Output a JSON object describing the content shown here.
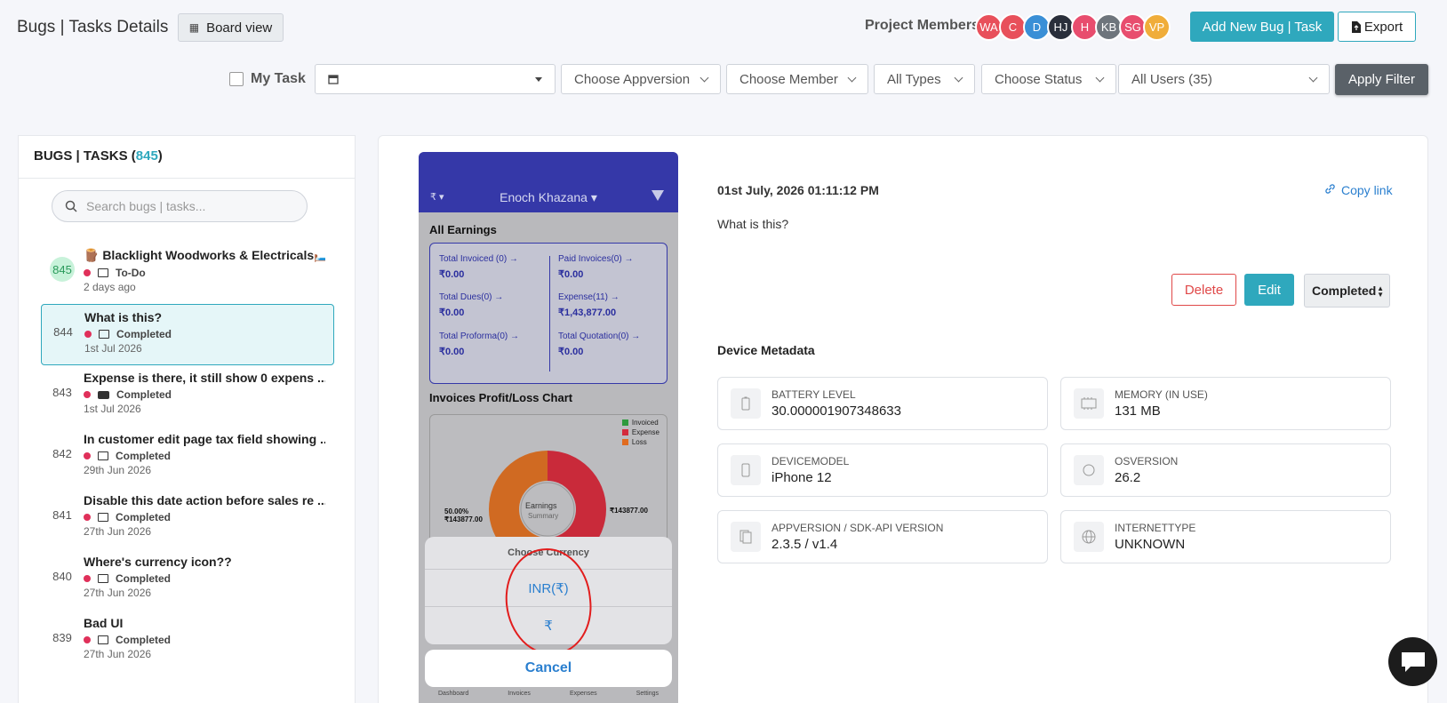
{
  "header": {
    "title": "Bugs | Tasks Details",
    "board_view": "Board view",
    "members_label": "Project Members",
    "members": [
      {
        "initials": "WA",
        "color": "#e8505b"
      },
      {
        "initials": "C",
        "color": "#e8505b"
      },
      {
        "initials": "D",
        "color": "#3a8fd6"
      },
      {
        "initials": "HJ",
        "color": "#2a2f3b"
      },
      {
        "initials": "H",
        "color": "#e84d6e"
      },
      {
        "initials": "KB",
        "color": "#6e757c"
      },
      {
        "initials": "SG",
        "color": "#e84d6e"
      },
      {
        "initials": "VP",
        "color": "#f0ad3a"
      }
    ],
    "add_button": "Add New Bug | Task",
    "export_button": "Export"
  },
  "filters": {
    "my_task": "My Task",
    "date_value": "",
    "appversion": "Choose Appversion",
    "member": "Choose Member",
    "types": "All Types",
    "status": "Choose Status",
    "users": "All Users (35)",
    "apply": "Apply Filter"
  },
  "list": {
    "heading_prefix": "BUGS | TASKS (",
    "count": "845",
    "heading_suffix": ")",
    "search_placeholder": "Search bugs | tasks...",
    "items": [
      {
        "num": "845",
        "title": "🪵 Blacklight Woodworks & Electricals🛏️ ...",
        "status": "To-Do",
        "date": "2 days ago",
        "media": "image"
      },
      {
        "num": "844",
        "title": "What is this?",
        "status": "Completed",
        "date": "1st Jul 2026",
        "media": "image"
      },
      {
        "num": "843",
        "title": "Expense is there, it still show 0 expens ...",
        "status": "Completed",
        "date": "1st Jul 2026",
        "media": "video"
      },
      {
        "num": "842",
        "title": "In customer edit page tax field showing ...",
        "status": "Completed",
        "date": "29th Jun 2026",
        "media": "image"
      },
      {
        "num": "841",
        "title": "Disable this date action before sales re ...",
        "status": "Completed",
        "date": "27th Jun 2026",
        "media": "image"
      },
      {
        "num": "840",
        "title": "Where's currency icon??",
        "status": "Completed",
        "date": "27th Jun 2026",
        "media": "image"
      },
      {
        "num": "839",
        "title": "Bad UI",
        "status": "Completed",
        "date": "27th Jun 2026",
        "media": "image"
      }
    ]
  },
  "phone": {
    "currency": "₹ ▾",
    "business": "Enoch Khazana ▾",
    "all_earnings": "All Earnings",
    "earnings": [
      {
        "label": "Total Invoiced (0) →",
        "value": "₹0.00"
      },
      {
        "label": "Paid Invoices(0) →",
        "value": "₹0.00"
      },
      {
        "label": "Total Dues(0) →",
        "value": "₹0.00"
      },
      {
        "label": "Expense(11) →",
        "value": "₹1,43,877.00"
      },
      {
        "label": "Total Proforma(0) →",
        "value": "₹0.00"
      },
      {
        "label": "Total Quotation(0) →",
        "value": "₹0.00"
      }
    ],
    "chart_title": "Invoices Profit/Loss Chart",
    "legend": [
      {
        "name": "Invoiced",
        "color": "#2e9a3e"
      },
      {
        "name": "Expense",
        "color": "#d32b3c"
      },
      {
        "name": "Loss",
        "color": "#e06b1f"
      }
    ],
    "donut_center": "Earnings",
    "donut_sub": "Summary",
    "label_left_pct": "50.00%",
    "label_left_val": "₹143877.00",
    "label_right_val": "₹143877.00",
    "sheet_title": "Choose Currency",
    "options": [
      "INR(₹)",
      "₹"
    ],
    "cancel": "Cancel",
    "tabs": [
      "Dashboard",
      "Invoices",
      "Expenses",
      "Settings"
    ]
  },
  "detail": {
    "datetime": "01st July, 2026 01:11:12 PM",
    "copy_link": "Copy link",
    "title": "What is this?",
    "delete": "Delete",
    "edit": "Edit",
    "status": "Completed",
    "metadata_heading": "Device Metadata",
    "metadata": [
      {
        "label": "BATTERY LEVEL",
        "value": "30.000001907348633",
        "icon": "battery-icon"
      },
      {
        "label": "MEMORY (IN USE)",
        "value": "131 MB",
        "icon": "memory-icon"
      },
      {
        "label": "DEVICEMODEL",
        "value": "iPhone 12",
        "icon": "phone-icon"
      },
      {
        "label": "OSVERSION",
        "value": "26.2",
        "icon": "os-icon"
      },
      {
        "label": "APPVERSION / SDK-API VERSION",
        "value": "2.3.5 / v1.4",
        "icon": "app-icon"
      },
      {
        "label": "INTERNETTYPE",
        "value": "UNKNOWN",
        "icon": "globe-icon"
      }
    ]
  }
}
